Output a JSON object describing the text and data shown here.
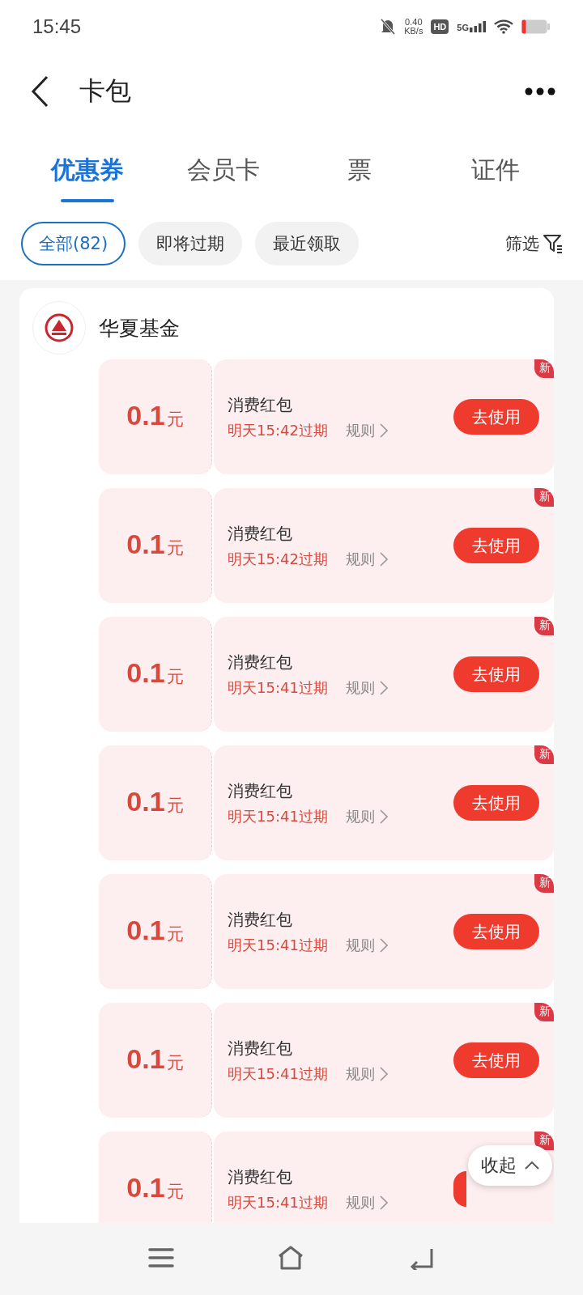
{
  "status_bar": {
    "time": "15:45",
    "net_speed": "0.40",
    "net_unit": "KB/s",
    "hd": "HD",
    "network": "5G"
  },
  "header": {
    "title": "卡包"
  },
  "tabs": [
    {
      "label": "优惠券",
      "selected": true
    },
    {
      "label": "会员卡",
      "selected": false
    },
    {
      "label": "票",
      "selected": false
    },
    {
      "label": "证件",
      "selected": false
    }
  ],
  "filters": [
    {
      "label": "全部(82)",
      "selected": true
    },
    {
      "label": "即将过期",
      "selected": false
    },
    {
      "label": "最近领取",
      "selected": false
    }
  ],
  "filter_button": "筛选",
  "store": {
    "name": "华夏基金"
  },
  "coupons": [
    {
      "amount": "0.1",
      "unit": "元",
      "title": "消费红包",
      "expiry": "明天15:42过期",
      "rules": "规则",
      "action": "去使用",
      "badge": "新"
    },
    {
      "amount": "0.1",
      "unit": "元",
      "title": "消费红包",
      "expiry": "明天15:42过期",
      "rules": "规则",
      "action": "去使用",
      "badge": "新"
    },
    {
      "amount": "0.1",
      "unit": "元",
      "title": "消费红包",
      "expiry": "明天15:41过期",
      "rules": "规则",
      "action": "去使用",
      "badge": "新"
    },
    {
      "amount": "0.1",
      "unit": "元",
      "title": "消费红包",
      "expiry": "明天15:41过期",
      "rules": "规则",
      "action": "去使用",
      "badge": "新"
    },
    {
      "amount": "0.1",
      "unit": "元",
      "title": "消费红包",
      "expiry": "明天15:41过期",
      "rules": "规则",
      "action": "去使用",
      "badge": "新"
    },
    {
      "amount": "0.1",
      "unit": "元",
      "title": "消费红包",
      "expiry": "明天15:41过期",
      "rules": "规则",
      "action": "去使用",
      "badge": "新"
    },
    {
      "amount": "0.1",
      "unit": "元",
      "title": "消费红包",
      "expiry": "明天15:41过期",
      "rules": "规则",
      "badge": "新"
    }
  ],
  "collapse_button": "收起"
}
